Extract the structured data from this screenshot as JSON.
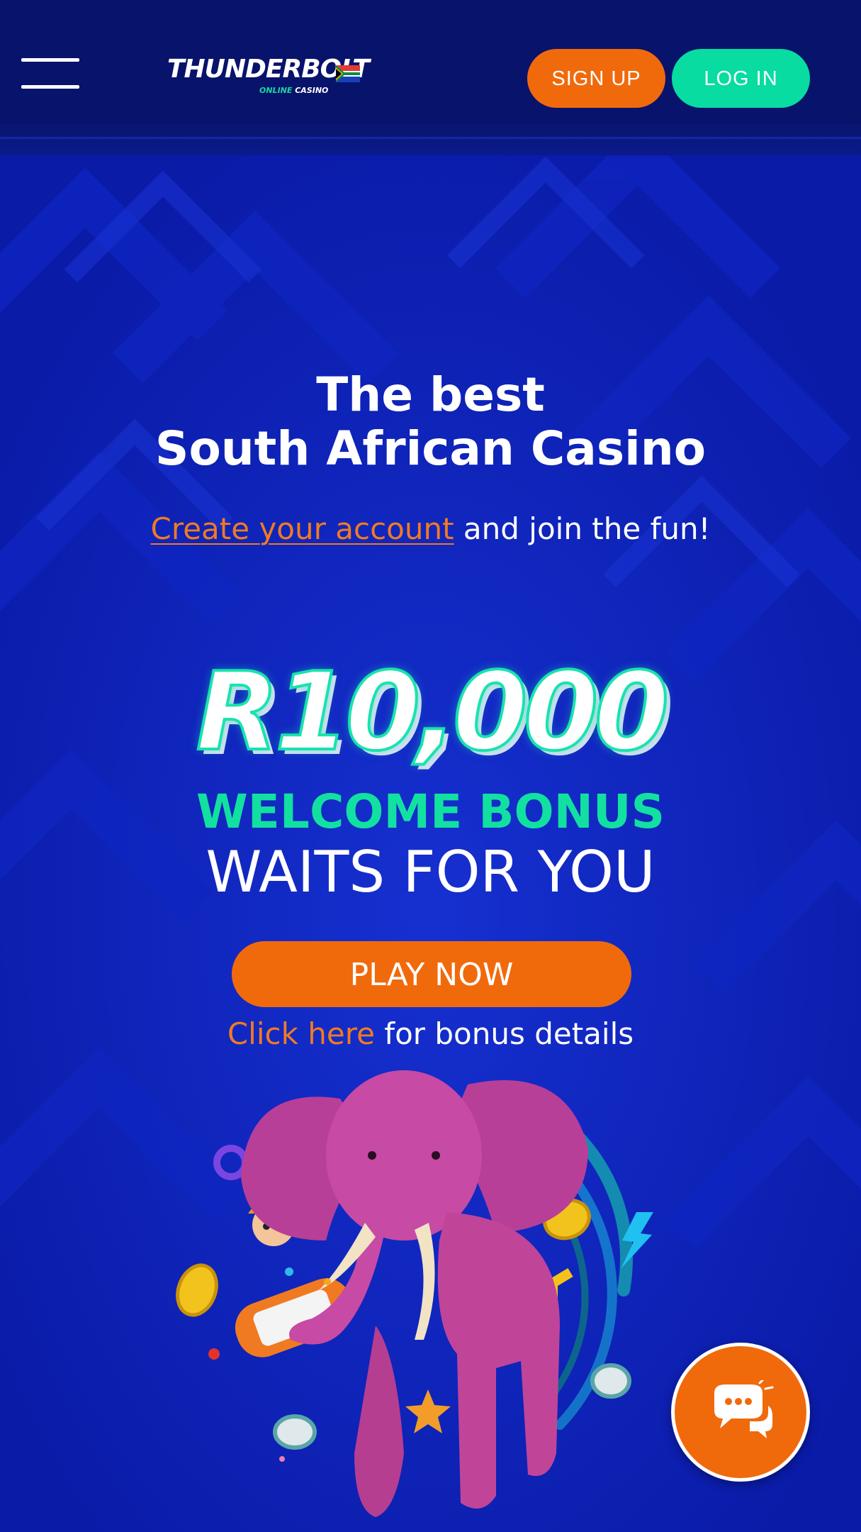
{
  "header": {
    "menu_icon": "hamburger-menu-icon",
    "logo": {
      "word": "THUNDERBOLT",
      "online": "ONLINE",
      "casino": "CASINO",
      "flag_icon": "south-africa-flag-icon"
    },
    "signup_label": "SIGN UP",
    "login_label": "LOG IN"
  },
  "hero": {
    "headline_line1": "The best",
    "headline_line2": "South African Casino",
    "cta_link": "Create your account",
    "cta_rest": " and join the fun!",
    "bonus_amount": "R10,000",
    "bonus_title": "WELCOME BONUS",
    "bonus_sub": "WAITS FOR YOU",
    "play_label": "PLAY NOW",
    "details_link": "Click here",
    "details_rest": " for bonus details",
    "art": "pink-elephant-casino-illustration"
  },
  "chat": {
    "icon": "chat-bubbles-icon"
  },
  "colors": {
    "header_bg": "#08136b",
    "hero_bg": "#0b1fb2",
    "accent_orange": "#f06a0c",
    "accent_green": "#08dca0",
    "bonus_green": "#12e0a0",
    "link_orange": "#f07a22",
    "elephant_pink": "#c0449e"
  }
}
